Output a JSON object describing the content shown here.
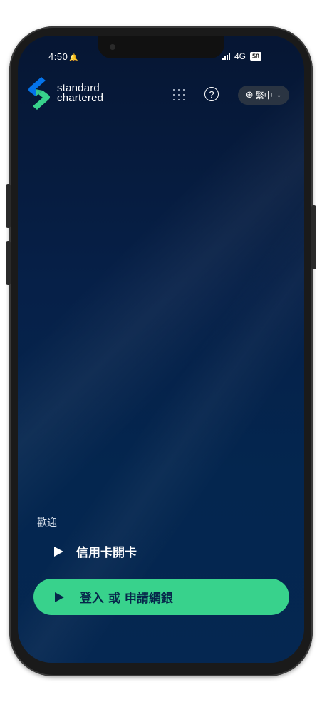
{
  "status_bar": {
    "time": "4:50",
    "notification_icon": "bell-icon",
    "network": "4G",
    "battery": "58"
  },
  "header": {
    "logo_line1": "standard",
    "logo_line2": "chartered",
    "apps_icon": "grid-icon",
    "help_icon": "question-icon",
    "help_symbol": "?",
    "language_icon": "globe-icon",
    "language_label": "繁中",
    "language_chevron": "⌄"
  },
  "main": {
    "welcome": "歡迎",
    "credit_card_link": "信用卡開卡",
    "primary_button": "登入 或 申請網銀"
  },
  "colors": {
    "background": "#062048",
    "accent": "#38d28c",
    "button_text": "#06264a",
    "logo_green": "#38d28c",
    "logo_blue": "#0473ea"
  }
}
